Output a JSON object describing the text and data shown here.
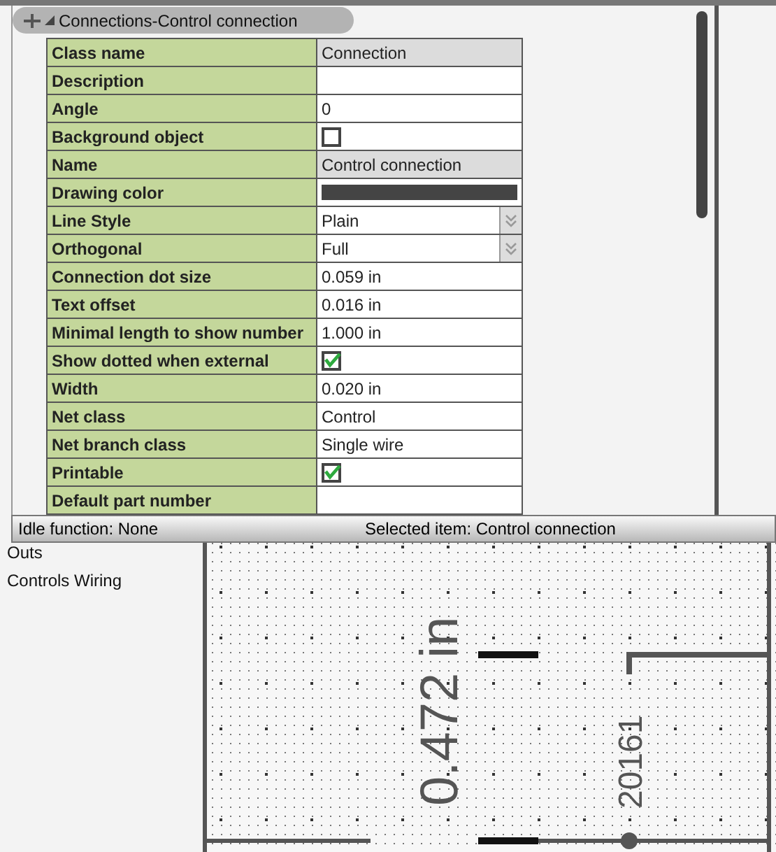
{
  "panel": {
    "title": "Connections-Control connection"
  },
  "properties": [
    {
      "label": "Class name",
      "kind": "text",
      "value": "Connection",
      "readonly": true
    },
    {
      "label": "Description",
      "kind": "text",
      "readonly": false
    },
    {
      "label": "Angle",
      "kind": "text",
      "value": "0",
      "readonly": false
    },
    {
      "label": "Background object",
      "kind": "checkbox",
      "checked": false
    },
    {
      "label": "Name",
      "kind": "text",
      "value": "Control connection",
      "readonly": true
    },
    {
      "label": "Drawing color",
      "kind": "color",
      "color": "#444444"
    },
    {
      "label": "Line Style",
      "kind": "select",
      "value": "Plain"
    },
    {
      "label": "Orthogonal",
      "kind": "select",
      "value": "Full"
    },
    {
      "label": "Connection dot size",
      "kind": "text",
      "value": "0.059 in",
      "readonly": false
    },
    {
      "label": "Text offset",
      "kind": "text",
      "value": "0.016 in",
      "readonly": false
    },
    {
      "label": "Minimal length to show number",
      "kind": "text",
      "value": "1.000 in",
      "readonly": false
    },
    {
      "label": "Show dotted when external",
      "kind": "checkbox",
      "checked": true
    },
    {
      "label": "Width",
      "kind": "text",
      "value": "0.020 in",
      "readonly": false
    },
    {
      "label": "Net class",
      "kind": "text",
      "value": "Control",
      "readonly": false
    },
    {
      "label": "Net branch class",
      "kind": "text",
      "value": "Single wire",
      "readonly": false
    },
    {
      "label": "Printable",
      "kind": "checkbox",
      "checked": true
    },
    {
      "label": "Default part number",
      "kind": "text",
      "readonly": false
    }
  ],
  "status_bar": {
    "left": "Idle function: None",
    "right": "Selected item: Control connection"
  },
  "tree": {
    "items": [
      "Outs",
      "Controls Wiring"
    ]
  },
  "drawing": {
    "dimension": "0.472 in",
    "wire_number": "20161"
  }
}
